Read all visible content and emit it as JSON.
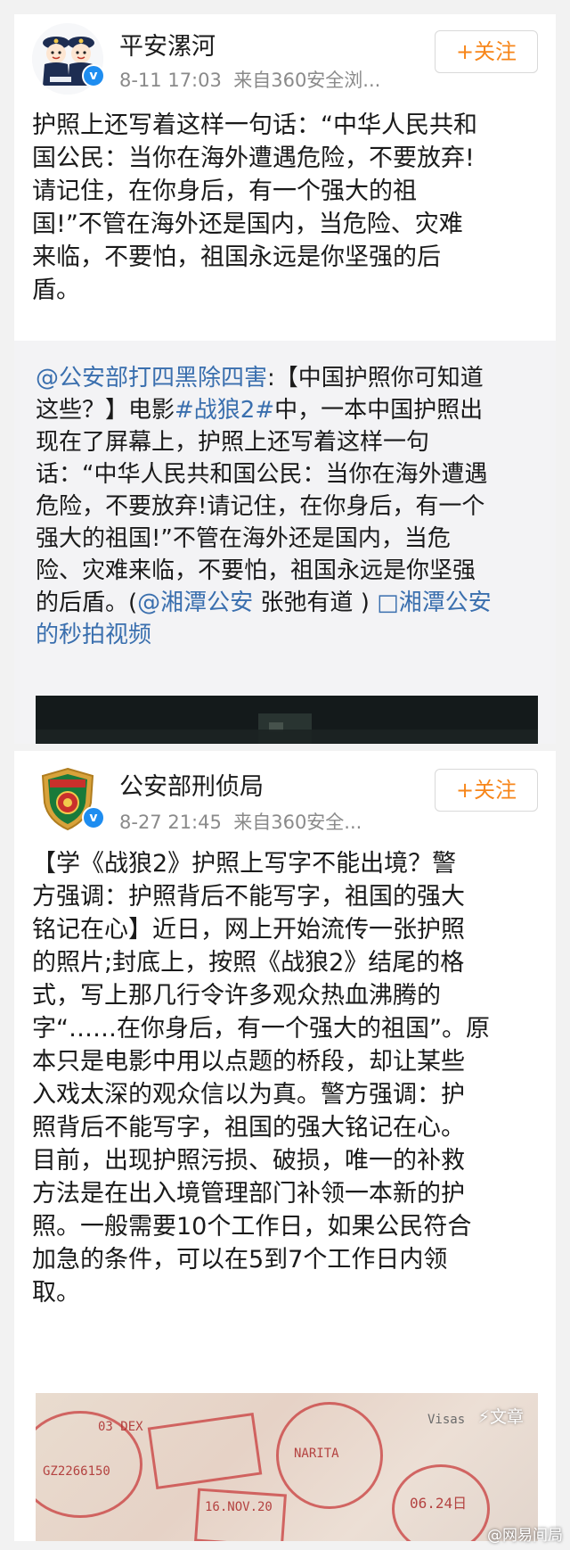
{
  "posts": [
    {
      "author": "平安漯河",
      "time": "8-11 17:03",
      "source": "来自360安全浏...",
      "follow_label": "+关注",
      "text_lines": [
        "护照上还写着这样一句话：“中华人民共和",
        "国公民：当你在海外遭遇危险，不要放弃!",
        "请记住，在你身后，有一个强大的祖",
        "国!”不管在海外还是国内，当危险、灾难",
        "来临，不要怕，祖国永远是你坚强的后",
        "盾。"
      ],
      "repost": {
        "line1_mention": "@公安部打四黑除四害",
        "line1_rest": ":【中国护照你可知道",
        "line2_a": "这些？】电影",
        "line2_hashtag": "#战狼2#",
        "line2_b": "中，一本中国护照出",
        "line3": "现在了屏幕上，护照上还写着这样一句",
        "line4": "话：“中华人民共和国公民：当你在海外遭遇",
        "line5": "危险，不要放弃!请记住，在你身后，有一个",
        "line6": "强大的祖国!”不管在海外还是国内，当危",
        "line7": "险、灾难来临，不要怕，祖国永远是你坚强",
        "line8_a": "的后盾。(",
        "line8_mention": "@湘潭公安",
        "line8_b": " 张弛有道 ) ",
        "line8_link": "□湘潭公安",
        "line9_link": "的秒拍视频"
      }
    },
    {
      "author": "公安部刑侦局",
      "time": "8-27 21:45",
      "source": "来自360安全...",
      "follow_label": "+关注",
      "text_lines": [
        "【学《战狼2》护照上写字不能出境？警",
        "方强调：护照背后不能写字，祖国的强大",
        "铭记在心】近日，网上开始流传一张护照",
        "的照片;封底上，按照《战狼2》结尾的格",
        "式，写上那几行令许多观众热血沸腾的",
        "字“……在你身后，有一个强大的祖国”。原",
        "本只是电影中用以点题的桥段，却让某些",
        "入戏太深的观众信以为真。警方强调：护",
        "照背后不能写字，祖国的强大铭记在心。",
        "目前，出现护照污损、破损，唯一的补救",
        "方法是在出入境管理部门补领一本新的护",
        "照。一般需要10个工作日，如果公民符合",
        "加急的条件，可以在5到7个工作日内领",
        "取。"
      ],
      "photo_badge": "⚡文章",
      "watermark": "@网易间局",
      "stamp_texts": [
        "03 DEX",
        "GZ2266150",
        "16.NOV.20",
        "06.24日",
        "Visas",
        "NARITA"
      ]
    }
  ],
  "colors": {
    "accent_orange": "#f7861a",
    "link_blue": "#3a6fae",
    "verified_blue": "#1e8df0"
  }
}
